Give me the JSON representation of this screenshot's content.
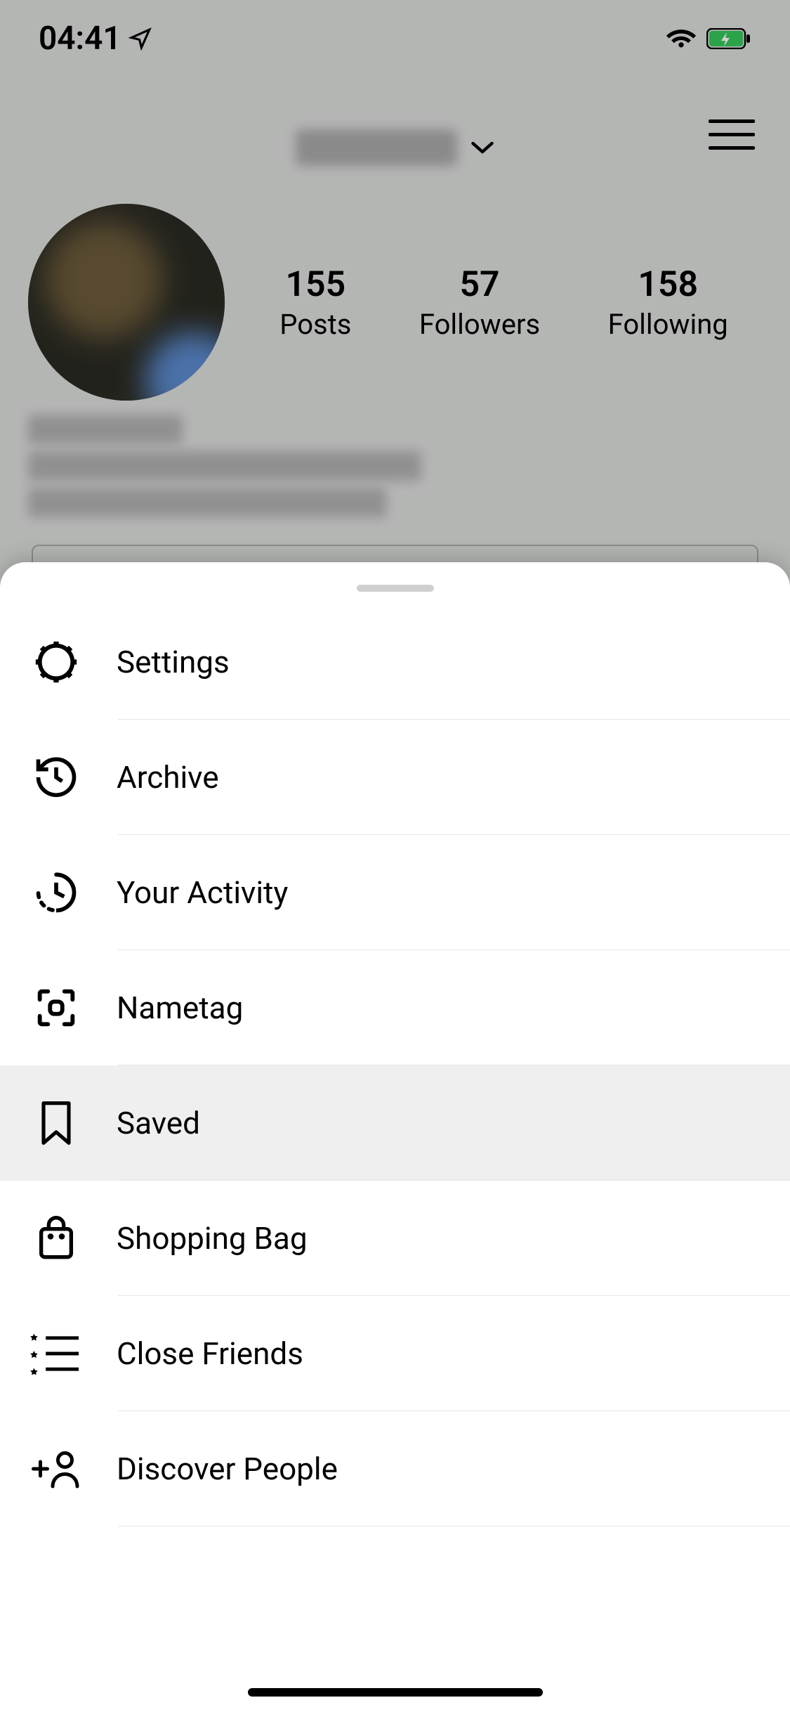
{
  "status": {
    "time": "04:41"
  },
  "profile": {
    "stats": {
      "posts": {
        "count": "155",
        "label": "Posts"
      },
      "followers": {
        "count": "57",
        "label": "Followers"
      },
      "following": {
        "count": "158",
        "label": "Following"
      }
    }
  },
  "menu": {
    "items": [
      {
        "label": "Settings",
        "icon": "gear-icon"
      },
      {
        "label": "Archive",
        "icon": "history-icon"
      },
      {
        "label": "Your Activity",
        "icon": "activity-icon"
      },
      {
        "label": "Nametag",
        "icon": "nametag-icon"
      },
      {
        "label": "Saved",
        "icon": "bookmark-icon"
      },
      {
        "label": "Shopping Bag",
        "icon": "shopping-bag-icon"
      },
      {
        "label": "Close Friends",
        "icon": "close-friends-icon"
      },
      {
        "label": "Discover People",
        "icon": "discover-people-icon"
      }
    ],
    "active_index": 4
  }
}
